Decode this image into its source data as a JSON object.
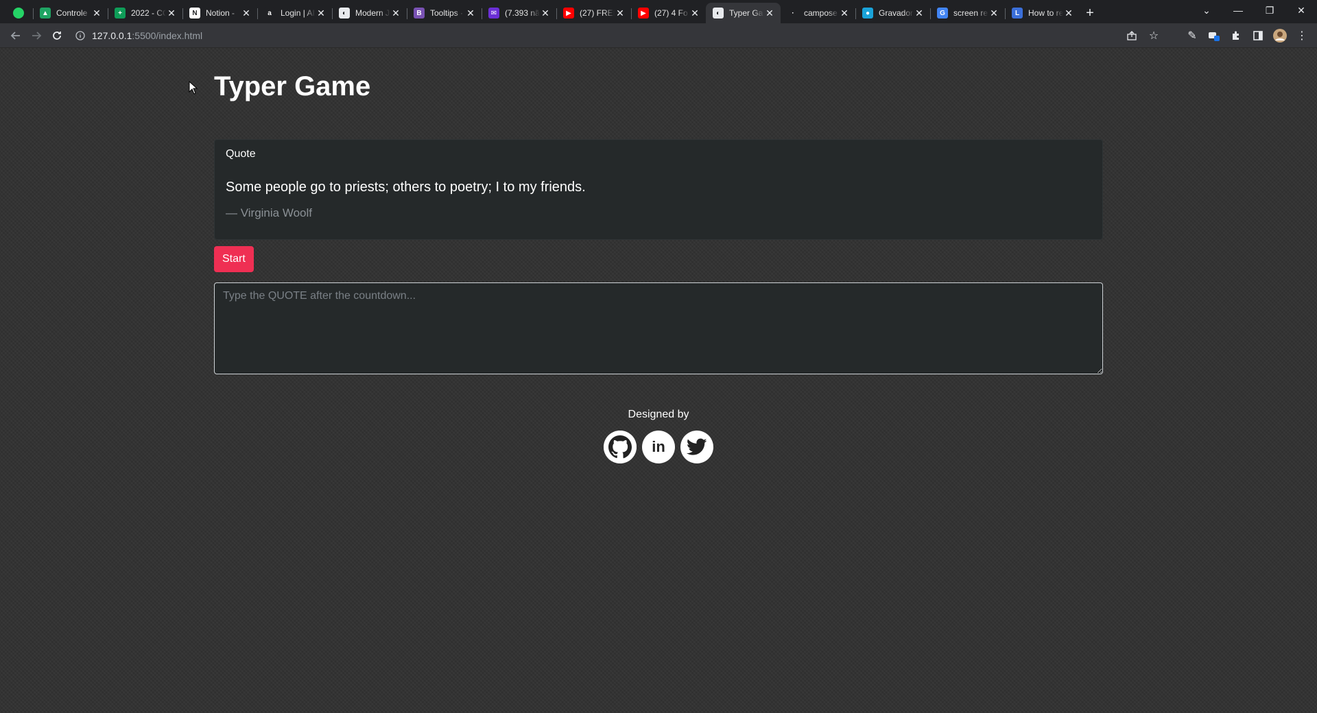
{
  "browser": {
    "tabs": [
      {
        "title": "",
        "favicon_color": "#25d366",
        "favicon_glyph": "",
        "pinned": true
      },
      {
        "title": "Controle",
        "favicon_color": "#1fa463",
        "favicon_glyph": "▲"
      },
      {
        "title": "2022 - CC",
        "favicon_color": "#0f9d58",
        "favicon_glyph": "+"
      },
      {
        "title": "Notion -",
        "favicon_color": "#ffffff",
        "favicon_glyph": "N"
      },
      {
        "title": "Login | AI",
        "favicon_color": "#202124",
        "favicon_glyph": "a"
      },
      {
        "title": "Modern J",
        "favicon_color": "#e8eaed",
        "favicon_glyph": "◐"
      },
      {
        "title": "Tooltips ·",
        "favicon_color": "#7952b3",
        "favicon_glyph": "B"
      },
      {
        "title": "(7.393 nã",
        "favicon_color": "#6b2fd6",
        "favicon_glyph": "✉"
      },
      {
        "title": "(27) FREE",
        "favicon_color": "#ff0000",
        "favicon_glyph": "▶"
      },
      {
        "title": "(27) 4 Fo",
        "favicon_color": "#ff0000",
        "favicon_glyph": "▶"
      },
      {
        "title": "Typer Ga",
        "favicon_color": "#e8eaed",
        "favicon_glyph": "◐",
        "active": true
      },
      {
        "title": "campose",
        "favicon_color": "#202124",
        "favicon_glyph": "·"
      },
      {
        "title": "Gravador",
        "favicon_color": "#1aa3d9",
        "favicon_glyph": "●"
      },
      {
        "title": "screen re",
        "favicon_color": "#4285f4",
        "favicon_glyph": "G"
      },
      {
        "title": "How to re",
        "favicon_color": "#3b6fd9",
        "favicon_glyph": "L"
      }
    ],
    "url_host": "127.0.0.1",
    "url_path": ":5500/index.html"
  },
  "page": {
    "title": "Typer Game",
    "quote_card": {
      "header": "Quote",
      "quote": "Some people go to priests; others to poetry; I to my friends.",
      "author": "— Virginia Woolf"
    },
    "start_label": "Start",
    "input_placeholder": "Type the QUOTE after the countdown...",
    "footer": {
      "text": "Designed by",
      "linkedin_label": "in"
    },
    "accent_color": "#ef2f53"
  }
}
